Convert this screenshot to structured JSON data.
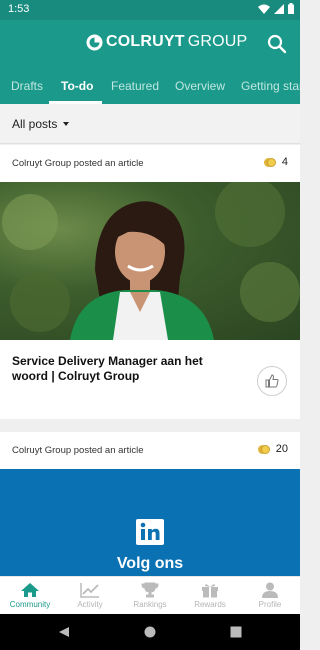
{
  "status_bar": {
    "time": "1:53"
  },
  "app_bar": {
    "logo_bold": "COLRUYT",
    "logo_light": "GROUP"
  },
  "tabs": [
    {
      "label": "Drafts"
    },
    {
      "label": "To-do"
    },
    {
      "label": "Featured"
    },
    {
      "label": "Overview"
    },
    {
      "label": "Getting start"
    }
  ],
  "filter": {
    "label": "All posts"
  },
  "posts": [
    {
      "author": "Colruyt Group posted an article",
      "coins": "4",
      "title": "Service Delivery Manager aan het woord | Colruyt Group"
    },
    {
      "author": "Colruyt Group posted an article",
      "coins": "20",
      "image_text": "Volg ons"
    }
  ],
  "bottom_nav": [
    {
      "label": "Community",
      "icon": "home-icon",
      "active": true
    },
    {
      "label": "Activity",
      "icon": "activity-icon",
      "active": false
    },
    {
      "label": "Rankings",
      "icon": "trophy-icon",
      "active": false
    },
    {
      "label": "Rewards",
      "icon": "gift-icon",
      "active": false
    },
    {
      "label": "Profile",
      "icon": "person-icon",
      "active": false
    }
  ],
  "colors": {
    "primary": "#1b9a8b",
    "status_bar": "#188a7e",
    "linkedin_blue": "#0a71b3",
    "coin": "#f2cc4a"
  }
}
